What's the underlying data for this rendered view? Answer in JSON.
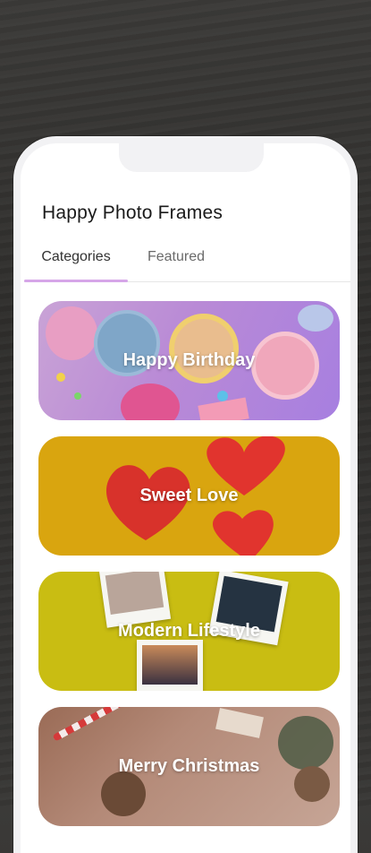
{
  "app": {
    "title": "Happy Photo Frames"
  },
  "tabs": [
    {
      "label": "Categories",
      "active": true
    },
    {
      "label": "Featured",
      "active": false
    }
  ],
  "categories": [
    {
      "label": "Happy Birthday"
    },
    {
      "label": "Sweet Love"
    },
    {
      "label": "Modern Lifestyle"
    },
    {
      "label": "Merry Christmas"
    }
  ],
  "colors": {
    "tab_indicator": "#d6a6e8",
    "birthday": "#b98ad6",
    "love": "#d9a50f",
    "heart": "#e1342e",
    "lifestyle": "#c9bd12",
    "christmas": "#b48a78"
  }
}
